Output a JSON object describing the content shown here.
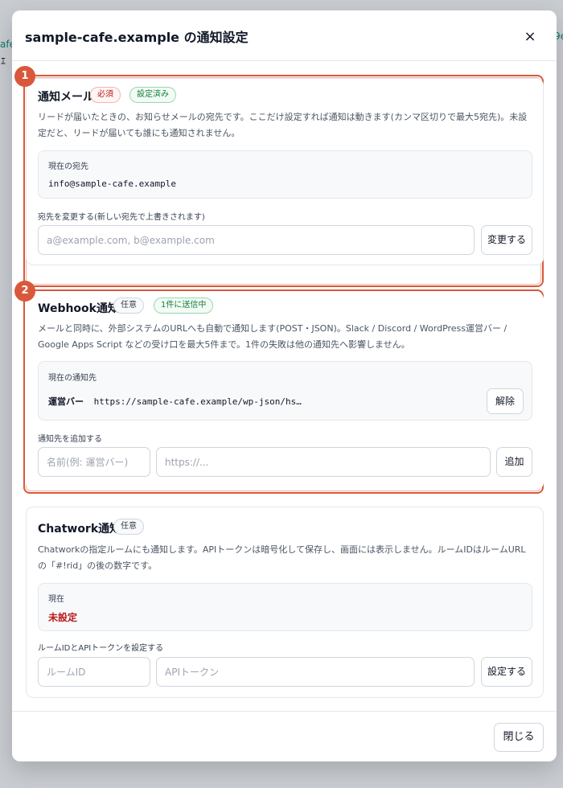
{
  "background": {
    "frag1": "afe",
    "frag2": "ｴ",
    "frag3": "9e"
  },
  "modal": {
    "title": "sample-cafe.example の通知設定",
    "close_icon": "×",
    "close_button": "閉じる"
  },
  "markers": [
    "1",
    "2"
  ],
  "email": {
    "title": "通知メール",
    "badge_required": "必須",
    "badge_status": "設定済み",
    "description": "リードが届いたときの、お知らせメールの宛先です。ここだけ設定すれば通知は動きます(カンマ区切りで最大5宛先)。未設定だと、リードが届いても誰にも通知されません。",
    "current_label": "現在の宛先",
    "current_value": "info@sample-cafe.example",
    "change_label": "宛先を変更する(新しい宛先で上書きされます)",
    "input_placeholder": "a@example.com, b@example.com",
    "change_button": "変更する"
  },
  "webhook": {
    "title": "Webhook通知",
    "badge_optional": "任意",
    "badge_status": "1件に送信中",
    "description": "メールと同時に、外部システムのURLへも自動で通知します(POST・JSON)。Slack / Discord / WordPress運営バー / Google Apps Script などの受け口を最大5件まで。1件の失敗は他の通知先へ影響しません。",
    "current_label": "現在の通知先",
    "current_name": "運営バー",
    "current_url": "https://sample-cafe.example/wp-json/hs…",
    "remove_button": "解除",
    "add_label": "通知先を追加する",
    "name_placeholder": "名前(例: 運営バー)",
    "url_placeholder": "https://...",
    "add_button": "追加"
  },
  "chatwork": {
    "title": "Chatwork通知",
    "badge_optional": "任意",
    "description": "Chatworkの指定ルームにも通知します。APIトークンは暗号化して保存し、画面には表示しません。ルームIDはルームURLの「#!rid」の後の数字です。",
    "current_label": "現在",
    "current_value": "未設定",
    "set_label": "ルームIDとAPIトークンを設定する",
    "room_placeholder": "ルームID",
    "token_placeholder": "APIトークン",
    "set_button": "設定する"
  },
  "colors": {
    "accent": "#d9583b",
    "danger": "#b91c1c",
    "success": "#15803d"
  }
}
